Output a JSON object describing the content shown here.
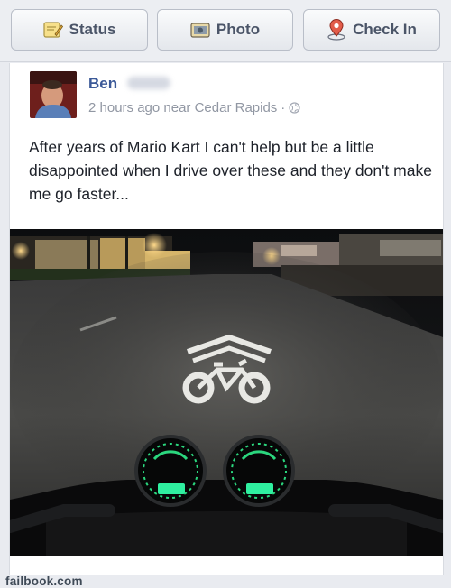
{
  "composer": {
    "tabs": [
      {
        "label": "Status",
        "icon": "status-pencil-icon"
      },
      {
        "label": "Photo",
        "icon": "photo-camera-icon"
      },
      {
        "label": "Check In",
        "icon": "location-pin-icon"
      }
    ]
  },
  "post": {
    "author": "Ben",
    "time": "2 hours ago near Cedar Rapids",
    "separator": "·",
    "privacy_icon": "globe-icon",
    "text": "After years of Mario Kart I can't help but be a little disappointed when I drive over these and they don't make me go faster..."
  },
  "watermark": "failbook.com",
  "colors": {
    "link_blue": "#3b5998",
    "meta_gray": "#9197a3",
    "speedo_green": "#22e08a"
  }
}
